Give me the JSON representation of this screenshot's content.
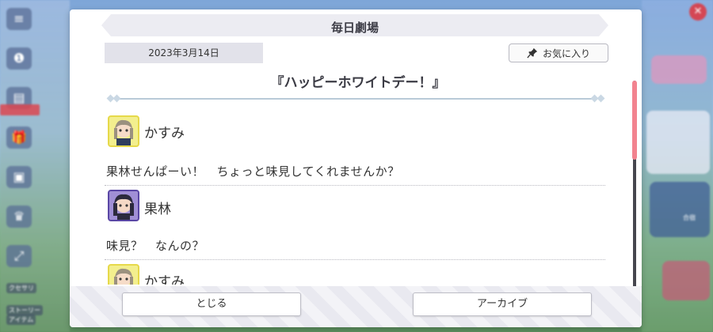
{
  "modal": {
    "title": "毎日劇場",
    "date": "2023年3月14日",
    "favorite_label": "お気に入り",
    "story_title": "『ハッピーホワイトデー！』",
    "entries": [
      {
        "speaker": "かすみ",
        "text": "果林せんぱーい！　ちょっと味見してくれませんか？"
      },
      {
        "speaker": "果林",
        "text": "味見？　なんの？"
      },
      {
        "speaker": "かすみ",
        "text": ""
      }
    ],
    "close_button": "とじる",
    "archive_button": "アーカイブ"
  },
  "background": {
    "left_menu": [
      "クセサリ",
      "ストーリー",
      "アイテム"
    ],
    "right_labels": [
      "合宿"
    ]
  },
  "colors": {
    "accent_pink": "#f2838f",
    "kasumi_yellow": "#f3ef8e",
    "karin_purple": "#8d78c9"
  }
}
